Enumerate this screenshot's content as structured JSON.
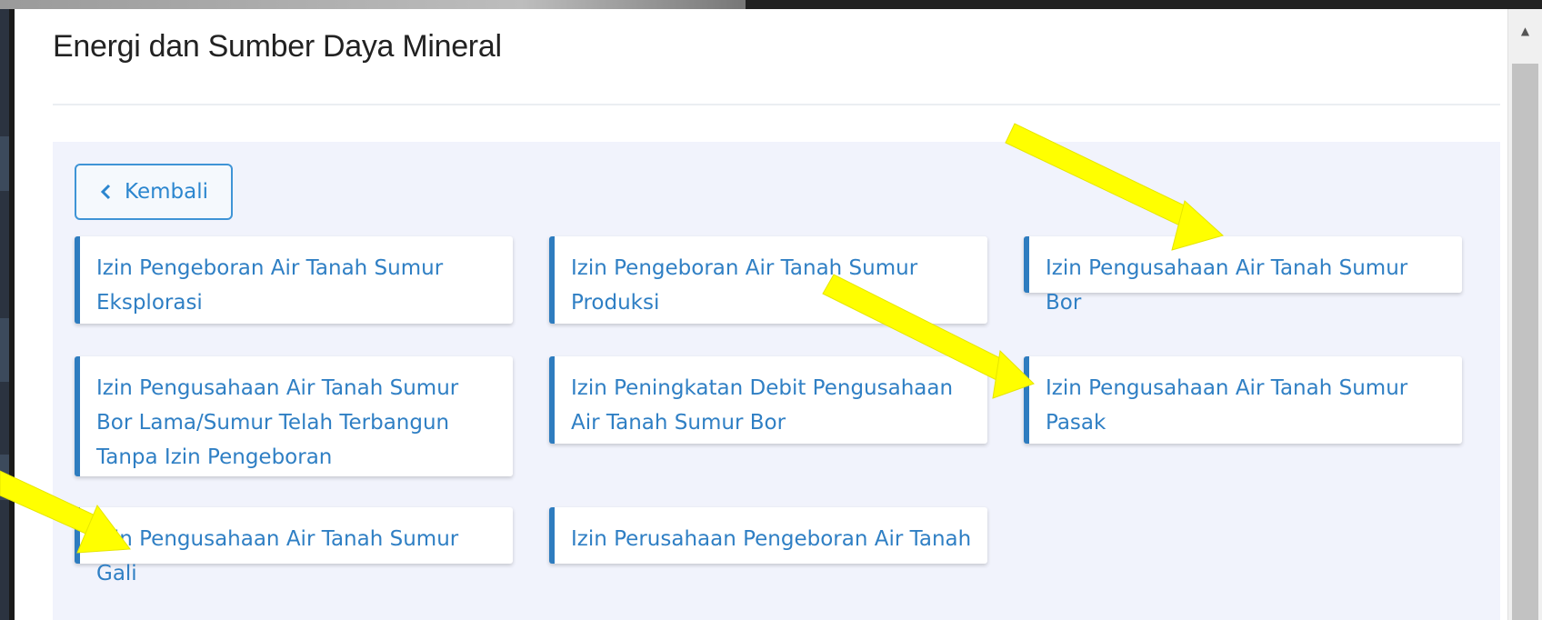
{
  "page": {
    "title": "Energi dan Sumber Daya Mineral"
  },
  "back_button": {
    "label": "Kembali",
    "icon": "chevron-left-icon"
  },
  "permit_cards": [
    {
      "label": "Izin Pengeboran Air Tanah Sumur Eksplorasi"
    },
    {
      "label": "Izin Pengeboran Air Tanah Sumur Produksi"
    },
    {
      "label": "Izin Pengusahaan Air Tanah Sumur Bor"
    },
    {
      "label": "Izin Pengusahaan Air Tanah Sumur Bor Lama/Sumur Telah Terbangun Tanpa Izin Pengeboran"
    },
    {
      "label": "Izin Peningkatan Debit Pengusahaan Air Tanah Sumur Bor"
    },
    {
      "label": "Izin Pengusahaan Air Tanah Sumur Pasak"
    },
    {
      "label": "Izin Pengusahaan Air Tanah Sumur Gali"
    },
    {
      "label": "Izin Perusahaan Pengeboran Air Tanah"
    }
  ],
  "annotations": {
    "arrow_color": "#ffff00",
    "arrow_targets": [
      "Izin Pengusahaan Air Tanah Sumur Bor",
      "Izin Pengusahaan Air Tanah Sumur Pasak",
      "Izin Pengusahaan Air Tanah Sumur Gali"
    ]
  },
  "colors": {
    "accent": "#2e7cbf",
    "link_text": "#2f7fc4",
    "content_bg": "#f1f3fc"
  }
}
